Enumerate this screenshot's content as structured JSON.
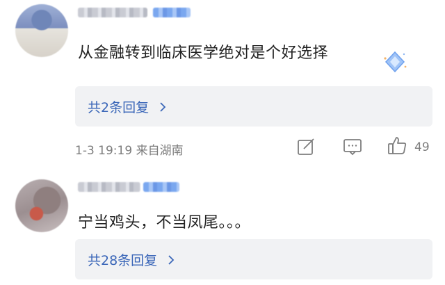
{
  "comments": [
    {
      "text": "从金融转到临床医学绝对是个好选择",
      "reply_link": "共2条回复",
      "meta": "1-3 19:19 来自湖南",
      "like_count": "49"
    },
    {
      "text": "宁当鸡头，不当凤尾。。。",
      "reply_link": "共28条回复"
    }
  ],
  "colors": {
    "link": "#3a66b8",
    "meta": "#7d7d7d",
    "reply_bg": "#f1f2f4",
    "text": "#222222"
  },
  "icons": {
    "share": "share-edit-icon",
    "comment": "comment-icon",
    "like": "thumbs-up-icon",
    "chevron": "chevron-right-icon",
    "decoration": "diamond-sticker-icon"
  }
}
